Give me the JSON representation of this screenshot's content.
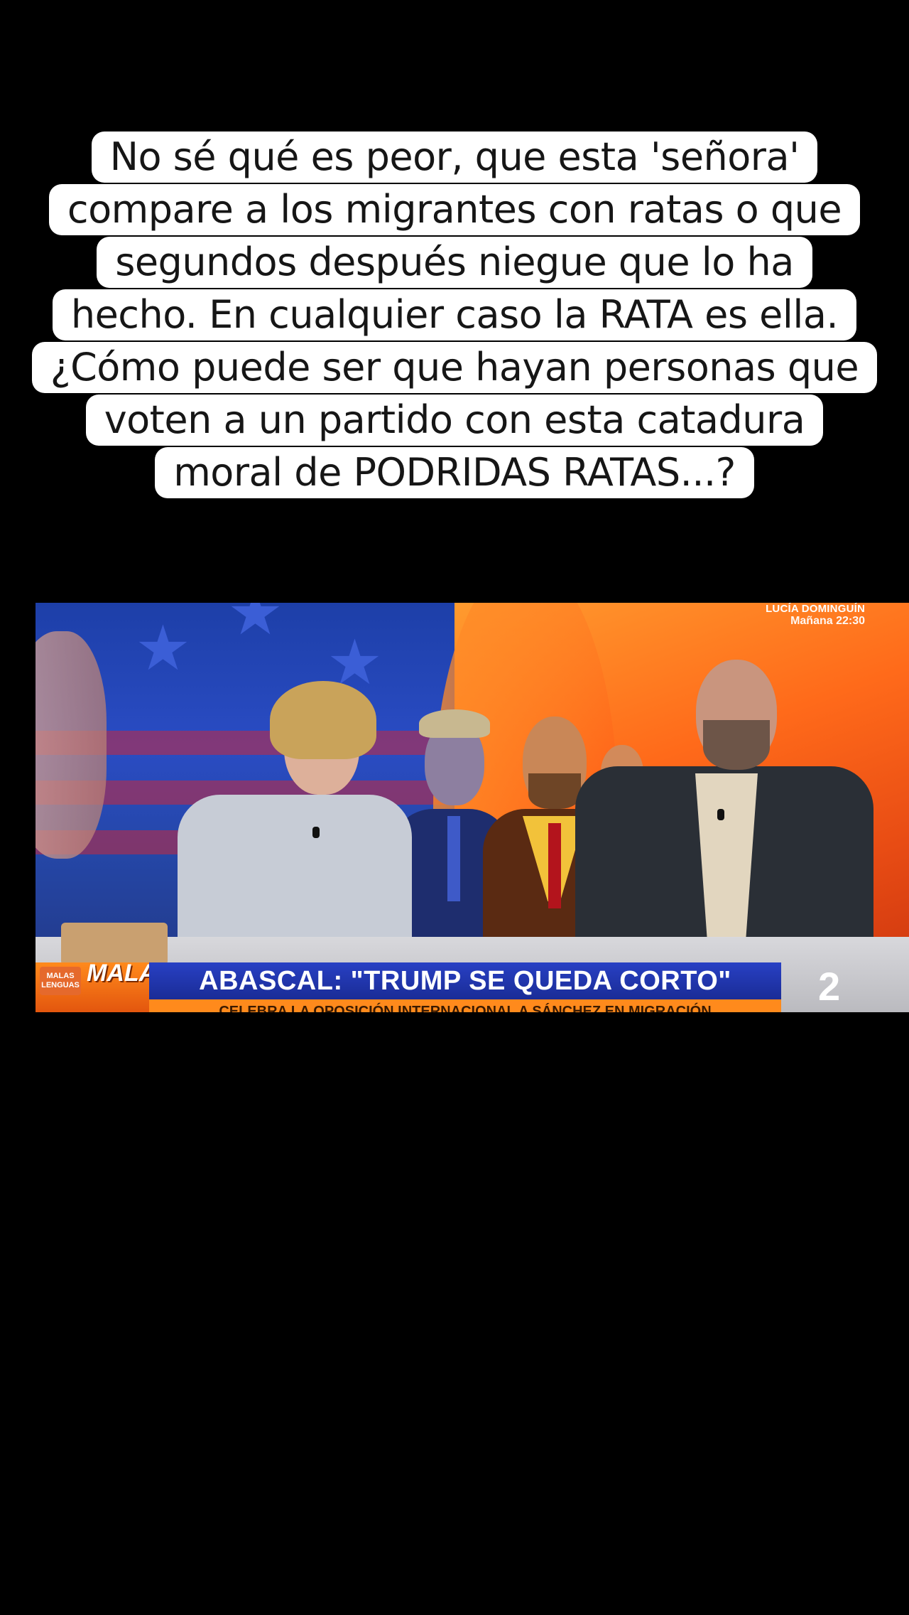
{
  "caption": {
    "lines": [
      "No sé qué es peor, que esta 'señora'",
      "compare a los migrantes con ratas o que",
      "segundos después niegue que lo ha",
      "hecho. En cualquier caso la RATA es ella.",
      "¿Cómo puede ser que hayan personas que",
      "voten a un partido con esta catadura",
      "moral de PODRIDAS RATAS...?"
    ]
  },
  "video": {
    "promo_name": "LUCÍA DOMINGUÍN",
    "promo_time": "Mañana 22:30",
    "show_logo": "MALAS LENGUAS",
    "show_badge": "MALAS LENGUAS",
    "headline": "ABASCAL: \"TRUMP SE QUEDA CORTO\"",
    "subheadline": "CELEBRA LA OPOSICIÓN INTERNACIONAL A SÁNCHEZ EN MIGRACIÓN",
    "channel": "2"
  },
  "colors": {
    "lower_third_blue": "#1f34b0",
    "lower_third_orange": "#ff8a1c"
  }
}
